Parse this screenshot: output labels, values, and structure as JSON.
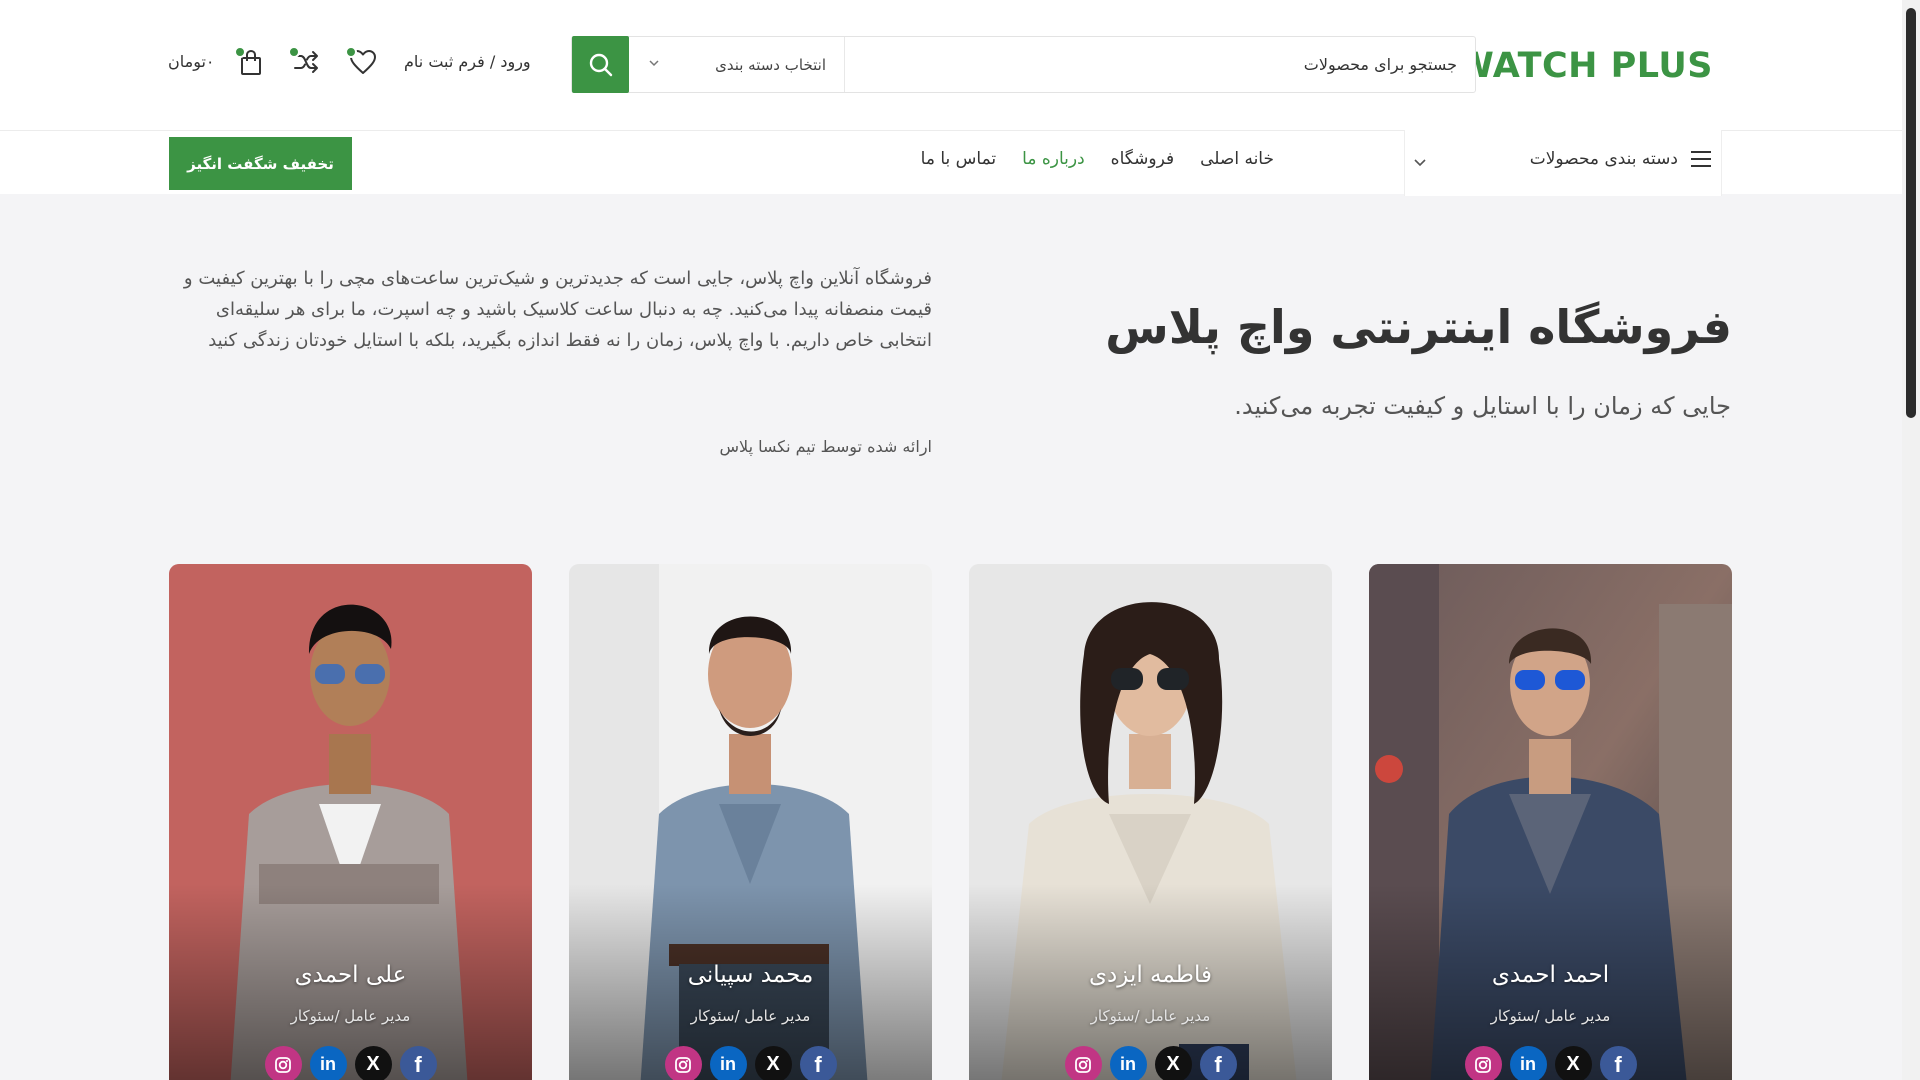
{
  "header": {
    "logo": "WATCH PLUS",
    "search": {
      "placeholder": "جستجو برای محصولات",
      "category_label": "انتخاب دسته بندی"
    },
    "login_label": "ورود / فرم ثبت نام",
    "cart_total": "۰تومان",
    "badges": {
      "wishlist": "0",
      "compare": "0",
      "cart": "0"
    }
  },
  "nav": {
    "category_menu_label": "دسته بندی محصولات",
    "links": [
      {
        "label": "خانه اصلی",
        "active": false
      },
      {
        "label": "فروشگاه",
        "active": false
      },
      {
        "label": "درباره ما",
        "active": true
      },
      {
        "label": "تماس با ما",
        "active": false
      }
    ],
    "promo_button": "تخفیف شگفت انگیز"
  },
  "hero": {
    "title": "فروشگاه اینترنتی واچ پلاس",
    "subtitle": "جایی که زمان را با استایل و کیفیت تجربه می‌کنید.",
    "description": "فروشگاه آنلاین واچ پلاس، جایی است که جدیدترین و شیک‌ترین ساعت‌های مچی را با بهترین کیفیت و قیمت منصفانه پیدا می‌کنید. چه به دنبال ساعت کلاسیک باشید و چه اسپرت، ما برای هر سلیقه‌ای انتخابی خاص داریم. با واچ پلاس، زمان را نه فقط اندازه بگیرید، بلکه با استایل خودتان زندگی کنید",
    "credit": "ارائه شده توسط تیم نکسا پلاس"
  },
  "team": [
    {
      "name": "احمد احمدی",
      "role": "مدیر عامل /سئوکار"
    },
    {
      "name": "فاطمه ایزدی",
      "role": "مدیر عامل /سئوکار"
    },
    {
      "name": "محمد سپیانی",
      "role": "مدیر عامل /سئوکار"
    },
    {
      "name": "علی احمدی",
      "role": "مدیر عامل /سئوکار"
    }
  ],
  "social_icons": [
    "facebook-icon",
    "x-icon",
    "linkedin-icon",
    "instagram-icon"
  ],
  "colors": {
    "brand": "#3c9444",
    "text": "#333333",
    "background": "#f4f4f6"
  }
}
